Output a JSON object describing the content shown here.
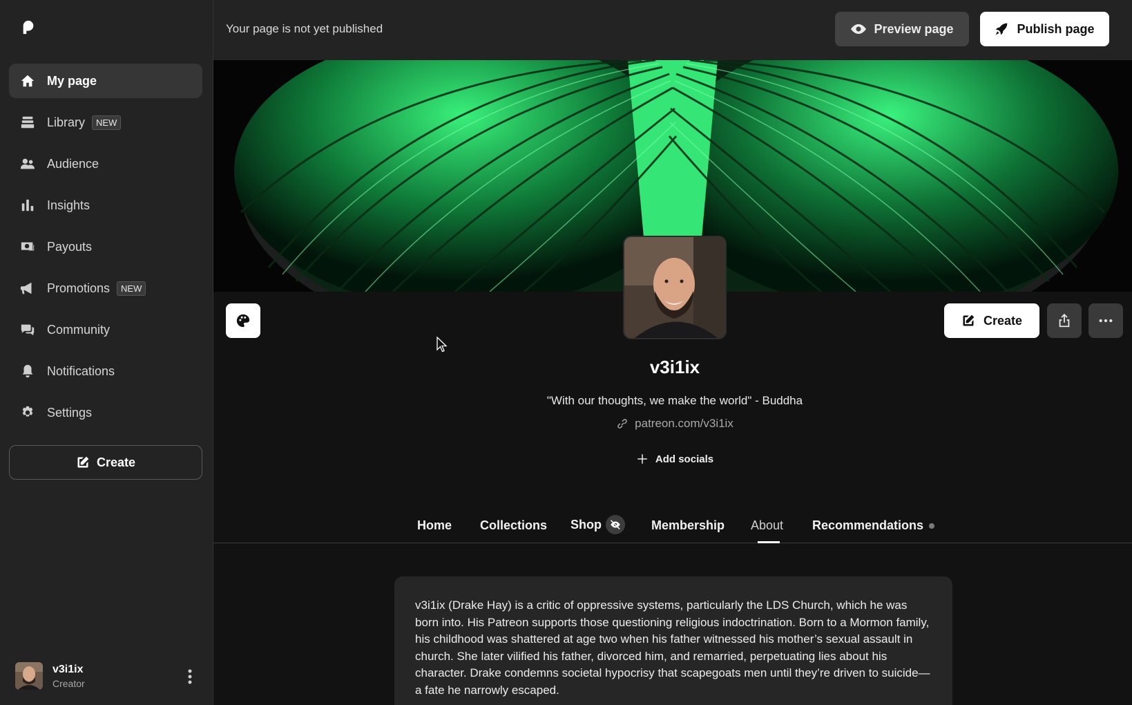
{
  "sidebar": {
    "nav": [
      {
        "label": "My page",
        "icon": "home-icon",
        "active": true
      },
      {
        "label": "Library",
        "icon": "library-icon",
        "badge": "NEW"
      },
      {
        "label": "Audience",
        "icon": "audience-icon"
      },
      {
        "label": "Insights",
        "icon": "insights-icon"
      },
      {
        "label": "Payouts",
        "icon": "payouts-icon"
      },
      {
        "label": "Promotions",
        "icon": "megaphone-icon",
        "badge": "NEW"
      },
      {
        "label": "Community",
        "icon": "chat-icon"
      },
      {
        "label": "Notifications",
        "icon": "bell-icon"
      },
      {
        "label": "Settings",
        "icon": "gear-icon"
      }
    ],
    "create_label": "Create",
    "user": {
      "name": "v3i1ix",
      "role": "Creator"
    }
  },
  "topbar": {
    "status": "Your page is not yet published",
    "preview_label": "Preview page",
    "publish_label": "Publish page"
  },
  "profile": {
    "name": "v3i1ix",
    "quote": "\"With our thoughts, we make the world\" - Buddha",
    "link": "patreon.com/v3i1ix",
    "add_socials": "Add socials",
    "create_label": "Create"
  },
  "tabs": [
    "Home",
    "Collections",
    "Shop",
    "Membership",
    "About",
    "Recommendations"
  ],
  "active_tab": "About",
  "about": {
    "text": "v3i1ix (Drake Hay) is a critic of oppressive systems, particularly the LDS Church, which he was born into. His Patreon supports those questioning religious indoctrination. Born to a Mormon family, his childhood was shattered at age two when his father witnessed his mother’s sexual assault in church. She later vilified his father, divorced him, and remarried, perpetuating lies about his character. Drake condemns societal hypocrisy that scapegoats men until they’re driven to suicide—a fate he narrowly escaped."
  },
  "colors": {
    "sidebar_bg": "#232323",
    "page_bg": "#121212",
    "banner_green": "#2ee66a",
    "primary_button": "#ffffff"
  }
}
